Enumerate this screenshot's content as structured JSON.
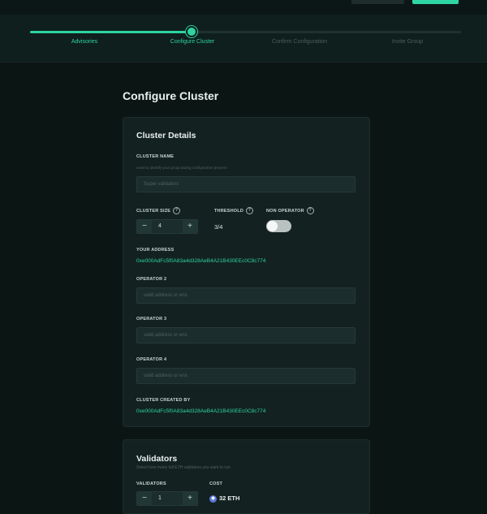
{
  "stepper": {
    "steps": [
      {
        "label": "Advisories"
      },
      {
        "label": "Configure Cluster"
      },
      {
        "label": "Confirm Configuration"
      },
      {
        "label": "Invite Group"
      }
    ]
  },
  "page": {
    "title": "Configure Cluster"
  },
  "details": {
    "title": "Cluster Details",
    "cluster_name": {
      "label": "CLUSTER NAME",
      "hint": "Used to identify your group during configuration process",
      "placeholder": "Super validators"
    },
    "cluster_size": {
      "label": "CLUSTER SIZE",
      "value": "4"
    },
    "threshold": {
      "label": "THRESHOLD",
      "value": "3/4"
    },
    "non_operator": {
      "label": "NON OPERATOR"
    },
    "your_address": {
      "label": "YOUR ADDRESS",
      "value": "0xe000AdFc5f0A83a4d328AeB4A21B430EEc0C8c774"
    },
    "operators": [
      {
        "label": "OPERATOR 2",
        "placeholder": "valid address or ens"
      },
      {
        "label": "OPERATOR 3",
        "placeholder": "valid address or ens"
      },
      {
        "label": "OPERATOR 4",
        "placeholder": "valid address or ens"
      }
    ],
    "created_by": {
      "label": "CLUSTER CREATED BY",
      "value": "0xe000AdFc5f0A83a4d328AeB4A21B430EEc0C8c774"
    }
  },
  "validators": {
    "title": "Validators",
    "hint": "Select how many full ETH validators you want to run",
    "count": {
      "label": "VALIDATORS",
      "value": "1"
    },
    "cost": {
      "label": "COST",
      "value": "32 ETH"
    }
  },
  "colors": {
    "accent": "#2ed39e",
    "background": "#0a1514",
    "card": "#132221"
  }
}
